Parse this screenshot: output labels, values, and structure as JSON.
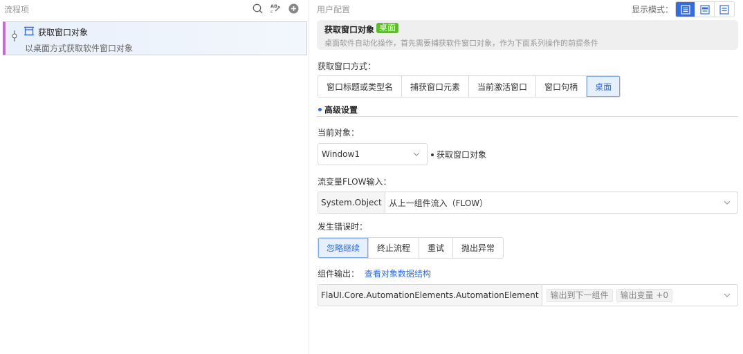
{
  "left_panel": {
    "title": "流程项",
    "flow_item": {
      "title": "获取窗口对象",
      "description": "以桌面方式获取软件窗口对象"
    }
  },
  "right_panel": {
    "title": "用户配置",
    "display_mode_label": "显示模式：",
    "info": {
      "title": "获取窗口对象",
      "tag": "桌面",
      "description": "桌面软件自动化操作，首先需要捕获软件窗口对象，作为下面系列操作的前提条件"
    },
    "window_mode": {
      "label": "获取窗口方式：",
      "options": [
        "窗口标题或类型名",
        "捕获窗口元素",
        "当前激活窗口",
        "窗口句柄",
        "桌面"
      ],
      "selected": "桌面"
    },
    "advanced_label": "高级设置",
    "current_object": {
      "label": "当前对象：",
      "value": "Window1",
      "hint": "获取窗口对象"
    },
    "flow_input": {
      "label": "流变量FLOW输入：",
      "type": "System.Object",
      "value": "从上一组件流入（FLOW）"
    },
    "on_error": {
      "label": "发生错误时：",
      "options": [
        "忽略继续",
        "终止流程",
        "重试",
        "抛出异常"
      ],
      "selected": "忽略继续"
    },
    "output": {
      "label": "组件输出：",
      "link": "查看对象数据结构",
      "type": "FlaUI.Core.AutomationElements.AutomationElement",
      "chips": [
        "输出到下一组件",
        "输出变量 +0"
      ]
    }
  },
  "colors": {
    "accent": "#2f6ce5",
    "tag_green": "#52c41a",
    "flow_marker": "#c86ad6"
  },
  "icons": [
    "search-icon",
    "abc-icon",
    "add-icon",
    "pin-icon",
    "window-icon",
    "mode-icon-1",
    "mode-icon-2",
    "mode-icon-3",
    "chevron-down-icon"
  ]
}
